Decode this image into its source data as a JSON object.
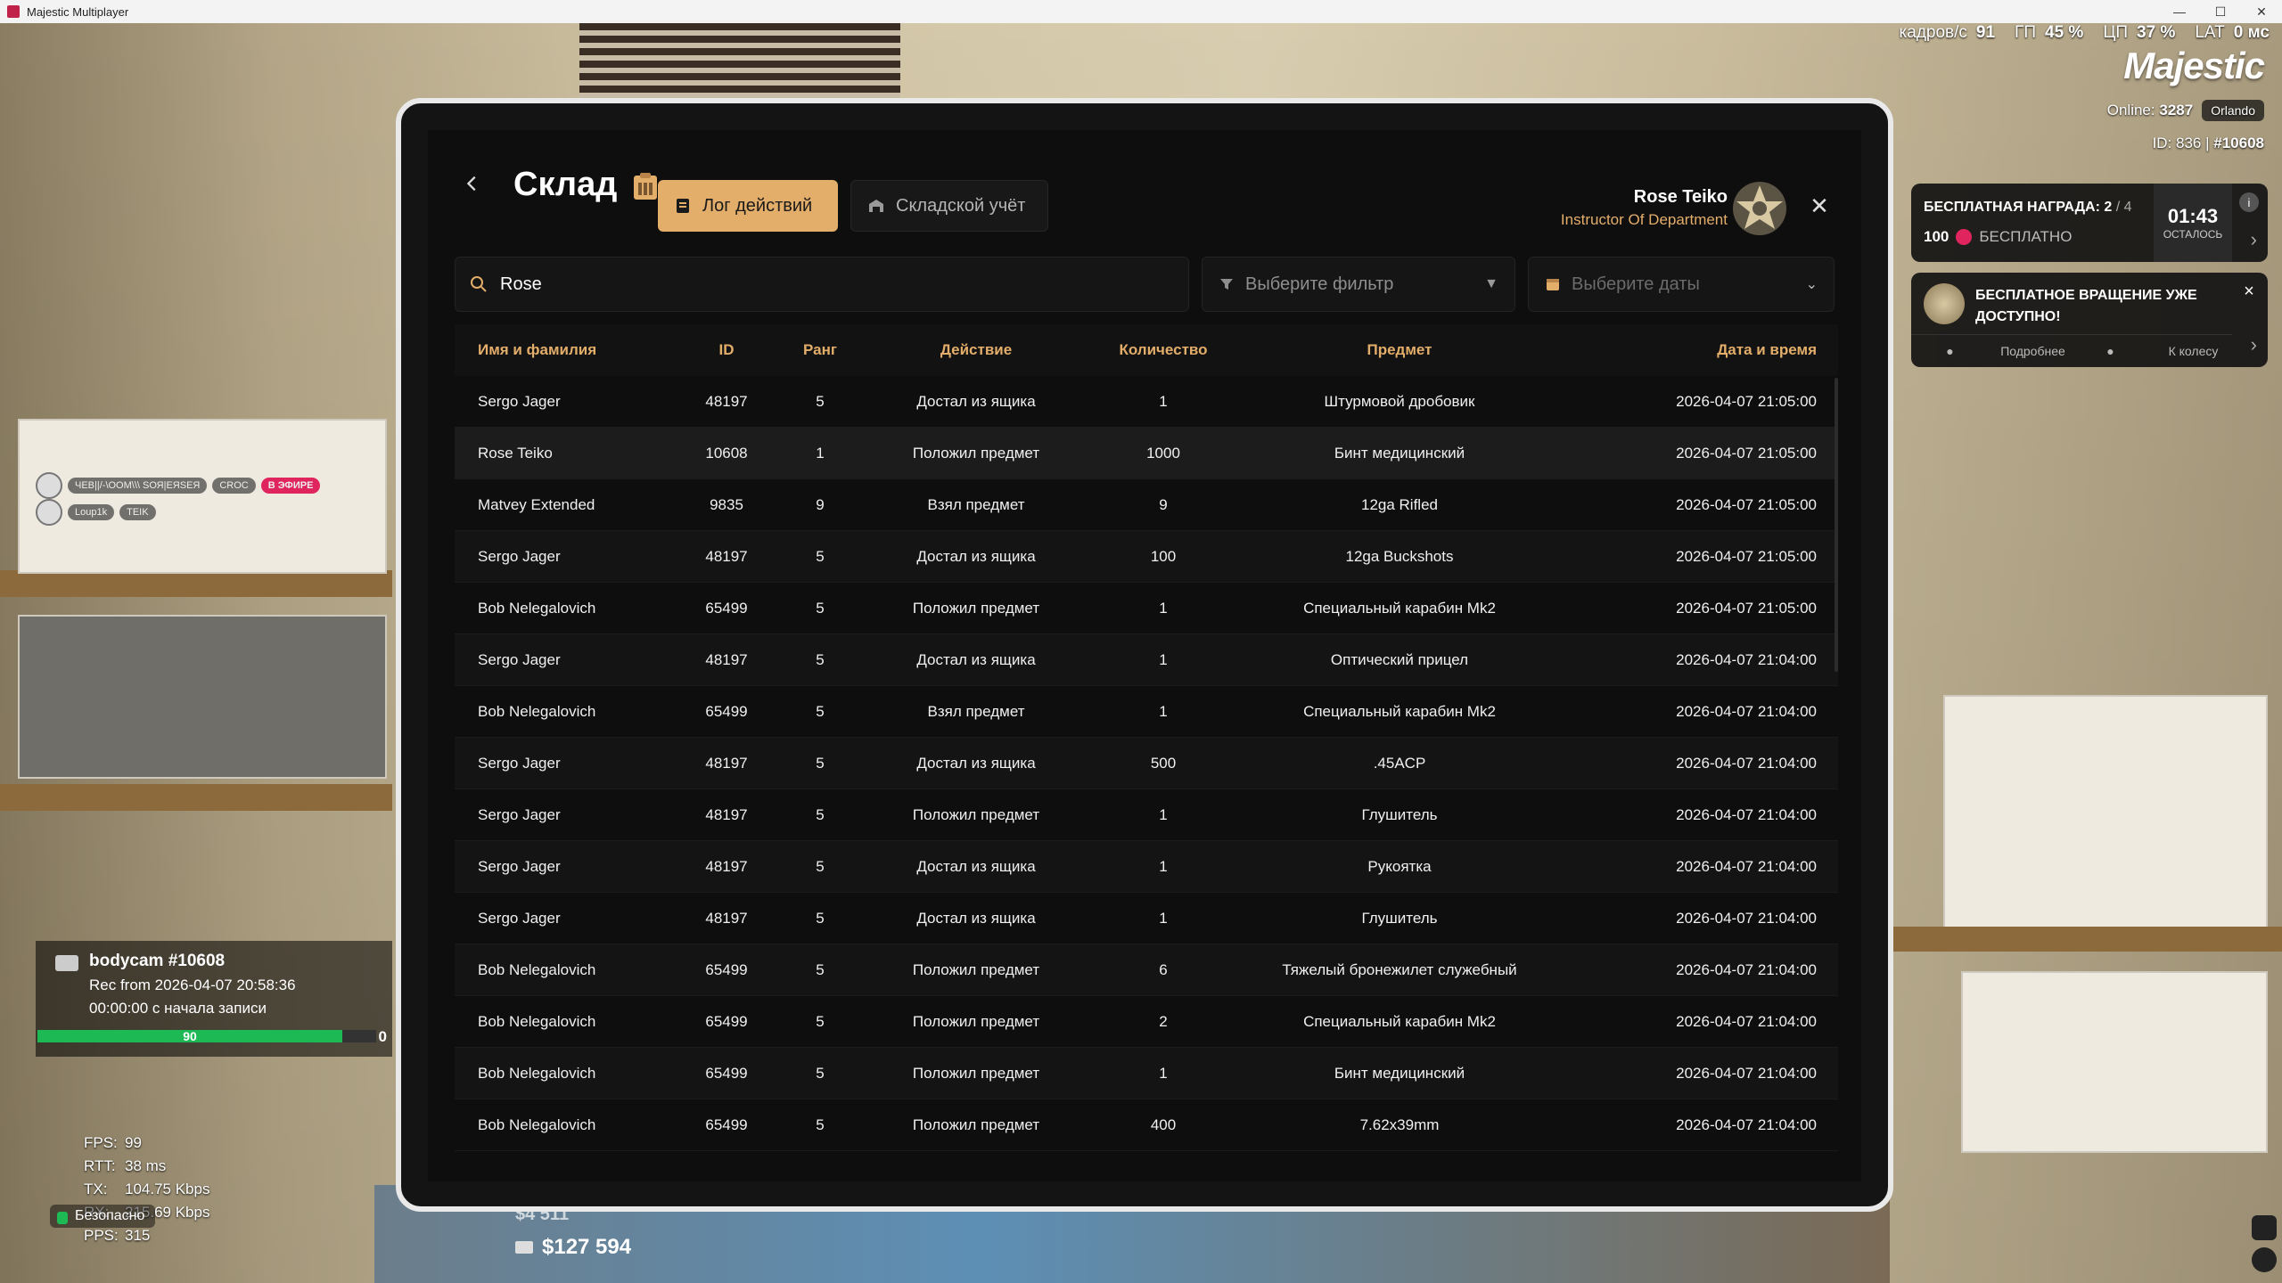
{
  "window": {
    "title": "Majestic Multiplayer"
  },
  "hud": {
    "stats": [
      {
        "label": "кадров/с",
        "value": "91"
      },
      {
        "label": "ГП",
        "value": "45 %"
      },
      {
        "label": "ЦП",
        "value": "37 %"
      },
      {
        "label": "LAT",
        "value": "0 мс"
      }
    ],
    "logo": "Majestic",
    "online_label": "Online:",
    "online_count": "3287",
    "server": "Orlando",
    "id_label": "ID: 836 |",
    "id_value": "#10608"
  },
  "reward": {
    "title": "БЕСПЛАТНАЯ НАГРАДА: 2",
    "title_total": "/ 4",
    "amount": "100",
    "amount_label": "БЕСПЛАТНО",
    "timer": "01:43",
    "timer_label": "ОСТАЛОСЬ"
  },
  "spin": {
    "text": "БЕСПЛАТНОЕ ВРАЩЕНИЕ УЖЕ ДОСТУПНО!",
    "more": "Подробнее",
    "wheel": "К колесу"
  },
  "chat": {
    "line1": "ЧЕВ||/-\\ООМ\\\\\\ SОЯ|ЕЯSЕЯ",
    "croc": "CROC",
    "live": "В ЭФИРЕ",
    "user": "Loup1k",
    "tag": "TEIK"
  },
  "bodycam": {
    "title": "bodycam #10608",
    "rec": "Rec from 2026-04-07 20:58:36",
    "elapsed": "00:00:00 с начала записи",
    "health": "90",
    "armor": "0",
    "health_fraction": 0.9
  },
  "net": [
    {
      "k": "FPS:",
      "v": "99"
    },
    {
      "k": "RTT:",
      "v": "38 ms"
    },
    {
      "k": "TX:",
      "v": "104.75 Kbps"
    },
    {
      "k": "RX:",
      "v": "215.69 Kbps"
    },
    {
      "k": "PPS:",
      "v": "315"
    }
  ],
  "safe_zone": "Безопасно",
  "money": {
    "cash": "$4 511",
    "bank": "$127 594"
  },
  "panel": {
    "title": "Склад",
    "tab_log": "Лог действий",
    "tab_stock": "Складской учёт",
    "user_name": "Rose Teiko",
    "user_role": "Instructor Of Department",
    "search_value": "Rose",
    "filter_placeholder": "Выберите фильтр",
    "dates_placeholder": "Выберите даты",
    "columns": [
      "Имя и фамилия",
      "ID",
      "Ранг",
      "Действие",
      "Количество",
      "Предмет",
      "Дата и время"
    ],
    "rows": [
      [
        "Sergo Jager",
        "48197",
        "5",
        "Достал из ящика",
        "1",
        "Штурмовой дробовик",
        "2026-04-07 21:05:00"
      ],
      [
        "Rose Teiko",
        "10608",
        "1",
        "Положил предмет",
        "1000",
        "Бинт медицинский",
        "2026-04-07 21:05:00"
      ],
      [
        "Matvey Extended",
        "9835",
        "9",
        "Взял предмет",
        "9",
        "12ga Rifled",
        "2026-04-07 21:05:00"
      ],
      [
        "Sergo Jager",
        "48197",
        "5",
        "Достал из ящика",
        "100",
        "12ga Buckshots",
        "2026-04-07 21:05:00"
      ],
      [
        "Bob Nelegalovich",
        "65499",
        "5",
        "Положил предмет",
        "1",
        "Специальный карабин Mk2",
        "2026-04-07 21:05:00"
      ],
      [
        "Sergo Jager",
        "48197",
        "5",
        "Достал из ящика",
        "1",
        "Оптический прицел",
        "2026-04-07 21:04:00"
      ],
      [
        "Bob Nelegalovich",
        "65499",
        "5",
        "Взял предмет",
        "1",
        "Специальный карабин Mk2",
        "2026-04-07 21:04:00"
      ],
      [
        "Sergo Jager",
        "48197",
        "5",
        "Достал из ящика",
        "500",
        ".45ACP",
        "2026-04-07 21:04:00"
      ],
      [
        "Sergo Jager",
        "48197",
        "5",
        "Положил предмет",
        "1",
        "Глушитель",
        "2026-04-07 21:04:00"
      ],
      [
        "Sergo Jager",
        "48197",
        "5",
        "Достал из ящика",
        "1",
        "Рукоятка",
        "2026-04-07 21:04:00"
      ],
      [
        "Sergo Jager",
        "48197",
        "5",
        "Достал из ящика",
        "1",
        "Глушитель",
        "2026-04-07 21:04:00"
      ],
      [
        "Bob Nelegalovich",
        "65499",
        "5",
        "Положил предмет",
        "6",
        "Тяжелый бронежилет служебный",
        "2026-04-07 21:04:00"
      ],
      [
        "Bob Nelegalovich",
        "65499",
        "5",
        "Положил предмет",
        "2",
        "Специальный карабин Mk2",
        "2026-04-07 21:04:00"
      ],
      [
        "Bob Nelegalovich",
        "65499",
        "5",
        "Положил предмет",
        "1",
        "Бинт медицинский",
        "2026-04-07 21:04:00"
      ],
      [
        "Bob Nelegalovich",
        "65499",
        "5",
        "Положил предмет",
        "400",
        "7.62x39mm",
        "2026-04-07 21:04:00"
      ]
    ]
  },
  "colors": {
    "accent": "#e3ad6a",
    "brand": "#e0245e",
    "safe": "#1db954"
  }
}
